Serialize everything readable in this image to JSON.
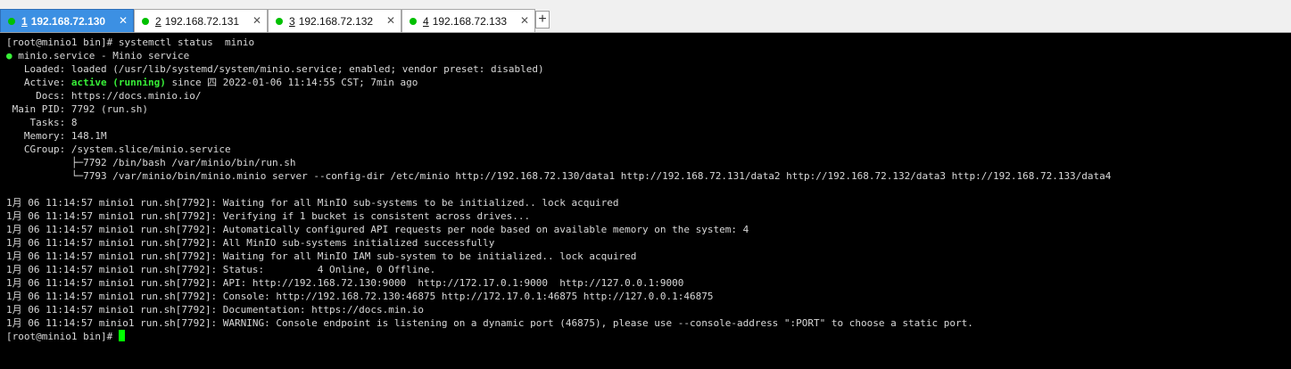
{
  "tabs": [
    {
      "num": "1",
      "label": "192.168.72.130",
      "active": true
    },
    {
      "num": "2",
      "label": "192.168.72.131",
      "active": false
    },
    {
      "num": "3",
      "label": "192.168.72.132",
      "active": false
    },
    {
      "num": "4",
      "label": "192.168.72.133",
      "active": false
    }
  ],
  "add_tab_label": "+",
  "close_glyph": "✕",
  "terminal": {
    "prompt": "[root@minio1 bin]# systemctl status  minio",
    "status_dot": "●",
    "service_line": " minio.service - Minio service",
    "loaded": "   Loaded: loaded (/usr/lib/systemd/system/minio.service; enabled; vendor preset: disabled)",
    "active_prefix": "   Active: ",
    "active_state": "active (running)",
    "active_suffix": " since 四 2022-01-06 11:14:55 CST; 7min ago",
    "docs": "     Docs: https://docs.minio.io/",
    "main_pid": " Main PID: 7792 (run.sh)",
    "tasks": "    Tasks: 8",
    "memory": "   Memory: 148.1M",
    "cgroup": "   CGroup: /system.slice/minio.service",
    "proc1": "           ├─7792 /bin/bash /var/minio/bin/run.sh",
    "proc2": "           └─7793 /var/minio/bin/minio.minio server --config-dir /etc/minio http://192.168.72.130/data1 http://192.168.72.131/data2 http://192.168.72.132/data3 http://192.168.72.133/data4",
    "logs": [
      "1月 06 11:14:57 minio1 run.sh[7792]: Waiting for all MinIO sub-systems to be initialized.. lock acquired",
      "1月 06 11:14:57 minio1 run.sh[7792]: Verifying if 1 bucket is consistent across drives...",
      "1月 06 11:14:57 minio1 run.sh[7792]: Automatically configured API requests per node based on available memory on the system: 4",
      "1月 06 11:14:57 minio1 run.sh[7792]: All MinIO sub-systems initialized successfully",
      "1月 06 11:14:57 minio1 run.sh[7792]: Waiting for all MinIO IAM sub-system to be initialized.. lock acquired",
      "1月 06 11:14:57 minio1 run.sh[7792]: Status:         4 Online, 0 Offline.",
      "1月 06 11:14:57 minio1 run.sh[7792]: API: http://192.168.72.130:9000  http://172.17.0.1:9000  http://127.0.0.1:9000",
      "1月 06 11:14:57 minio1 run.sh[7792]: Console: http://192.168.72.130:46875 http://172.17.0.1:46875 http://127.0.0.1:46875",
      "1月 06 11:14:57 minio1 run.sh[7792]: Documentation: https://docs.min.io",
      "1月 06 11:14:57 minio1 run.sh[7792]: WARNING: Console endpoint is listening on a dynamic port (46875), please use --console-address \":PORT\" to choose a static port."
    ],
    "final_prompt": "[root@minio1 bin]# "
  }
}
